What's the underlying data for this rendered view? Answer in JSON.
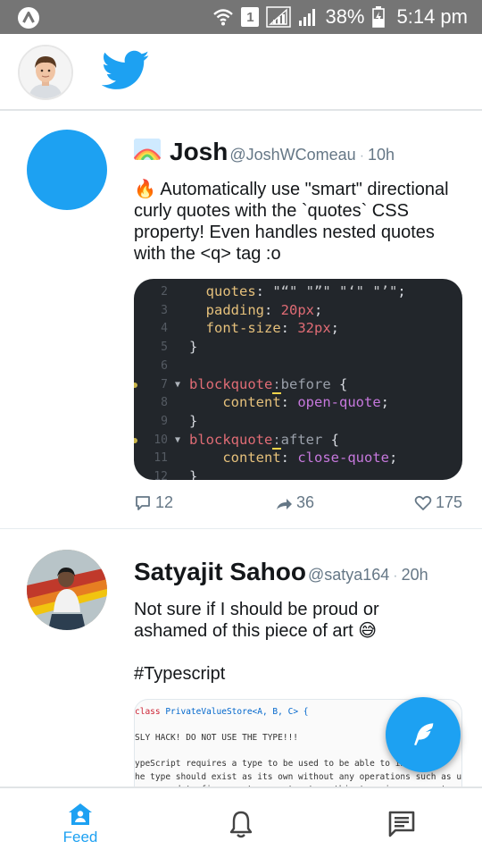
{
  "status_bar": {
    "battery": "38%",
    "time": "5:14 pm",
    "sim": "1"
  },
  "colors": {
    "accent": "#1da1f2",
    "status_bar_bg": "#757575",
    "code_bg": "#22262b"
  },
  "tweets": [
    {
      "name": "Josh",
      "handle": "@JoshWComeau",
      "time": "10h",
      "name_badge_icon": "rainbow-flag-icon",
      "text": "🔥 Automatically use \"smart\" directional curly quotes with the `quotes` CSS property! Even handles nested quotes with the <q> tag :o",
      "code": {
        "lines": [
          {
            "n": "2",
            "tokens": [
              [
                "  ",
                ""
              ],
              [
                "quotes",
                "k-prop"
              ],
              [
                ": ",
                ""
              ],
              [
                "\"“\" \"”\" \"‘\" \"’\"",
                "k-str"
              ],
              [
                ";",
                ""
              ]
            ]
          },
          {
            "n": "3",
            "tokens": [
              [
                "  ",
                ""
              ],
              [
                "padding",
                "k-prop"
              ],
              [
                ": ",
                ""
              ],
              [
                "20px",
                "k-num"
              ],
              [
                ";",
                ""
              ]
            ]
          },
          {
            "n": "4",
            "tokens": [
              [
                "  ",
                ""
              ],
              [
                "font-size",
                "k-prop"
              ],
              [
                ": ",
                ""
              ],
              [
                "32px",
                "k-num"
              ],
              [
                ";",
                ""
              ]
            ]
          },
          {
            "n": "5",
            "tokens": [
              [
                "}",
                ""
              ]
            ]
          },
          {
            "n": "6",
            "tokens": []
          },
          {
            "n": "7",
            "fold": true,
            "mark": true,
            "tokens": [
              [
                "blockquote",
                "k-sel"
              ],
              [
                ":",
                "cursor k-pseudo"
              ],
              [
                "before",
                "k-pseudo"
              ],
              [
                " {",
                ""
              ]
            ]
          },
          {
            "n": "8",
            "tokens": [
              [
                "    ",
                ""
              ],
              [
                "content",
                "k-prop"
              ],
              [
                ": ",
                ""
              ],
              [
                "open-quote",
                "k-val"
              ],
              [
                ";",
                ""
              ]
            ]
          },
          {
            "n": "9",
            "tokens": [
              [
                "}",
                ""
              ]
            ]
          },
          {
            "n": "10",
            "fold": true,
            "mark": true,
            "tokens": [
              [
                "blockquote",
                "k-sel"
              ],
              [
                ":",
                "cursor k-pseudo"
              ],
              [
                "after",
                "k-pseudo"
              ],
              [
                " {",
                ""
              ]
            ]
          },
          {
            "n": "11",
            "tokens": [
              [
                "    ",
                ""
              ],
              [
                "content",
                "k-prop"
              ],
              [
                ": ",
                ""
              ],
              [
                "close-quote",
                "k-val"
              ],
              [
                ";",
                ""
              ]
            ]
          },
          {
            "n": "12",
            "tokens": [
              [
                "}",
                ""
              ]
            ]
          }
        ]
      },
      "replies": "12",
      "retweets": "36",
      "likes": "175"
    },
    {
      "name": "Satyajit Sahoo",
      "handle": "@satya164",
      "time": "20h",
      "text_line1": "Not sure if I should be proud or ashamed of this piece of art 😅",
      "text_line2": "#Typescript",
      "image_lines": [
        "class PrivateValueStore<A, B, C> {",
        "",
        "SLY HACK! DO NOT USE THE TYPE!!!",
        "",
        "ypeScript requires a type to be used to be able to infer it.",
        "he type should exist as its own without any operations such as union.",
        "o we need to figure out a way to store this type in a property."
      ]
    }
  ],
  "bottom_nav": {
    "feed_label": "Feed"
  }
}
